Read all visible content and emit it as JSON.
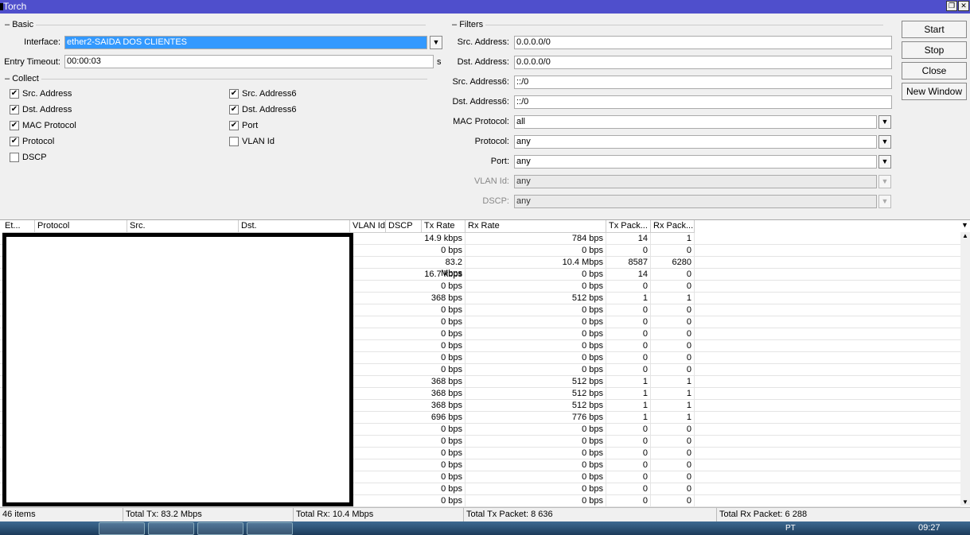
{
  "window": {
    "title": "Torch"
  },
  "basic": {
    "legend": "Basic",
    "interface_label": "Interface:",
    "interface_value": "ether2-SAIDA DOS CLIENTES",
    "timeout_label": "Entry Timeout:",
    "timeout_value": "00:00:03",
    "timeout_unit": "s"
  },
  "collect": {
    "legend": "Collect",
    "items": [
      {
        "label": "Src. Address",
        "checked": true
      },
      {
        "label": "Dst. Address",
        "checked": true
      },
      {
        "label": "MAC Protocol",
        "checked": true
      },
      {
        "label": "Protocol",
        "checked": true
      },
      {
        "label": "DSCP",
        "checked": false
      },
      {
        "label": "Src. Address6",
        "checked": true
      },
      {
        "label": "Dst. Address6",
        "checked": true
      },
      {
        "label": "Port",
        "checked": true
      },
      {
        "label": "VLAN Id",
        "checked": false
      }
    ]
  },
  "filters": {
    "legend": "Filters",
    "items": [
      {
        "label": "Src. Address:",
        "value": "0.0.0.0/0",
        "dropdown": false,
        "disabled": false
      },
      {
        "label": "Dst. Address:",
        "value": "0.0.0.0/0",
        "dropdown": false,
        "disabled": false
      },
      {
        "label": "Src. Address6:",
        "value": "::/0",
        "dropdown": false,
        "disabled": false
      },
      {
        "label": "Dst. Address6:",
        "value": "::/0",
        "dropdown": false,
        "disabled": false
      },
      {
        "label": "MAC Protocol:",
        "value": "all",
        "dropdown": true,
        "disabled": false
      },
      {
        "label": "Protocol:",
        "value": "any",
        "dropdown": true,
        "disabled": false
      },
      {
        "label": "Port:",
        "value": "any",
        "dropdown": true,
        "disabled": false
      },
      {
        "label": "VLAN Id:",
        "value": "any",
        "dropdown": true,
        "disabled": true
      },
      {
        "label": "DSCP:",
        "value": "any",
        "dropdown": true,
        "disabled": true
      }
    ]
  },
  "buttons": {
    "start": "Start",
    "stop": "Stop",
    "close": "Close",
    "new_window": "New Window"
  },
  "table": {
    "columns": [
      "Et...",
      "Protocol",
      "Src.",
      "Dst.",
      "VLAN Id",
      "DSCP",
      "Tx Rate",
      "Rx Rate",
      "Tx Pack...",
      "Rx Pack..."
    ],
    "rows": [
      [
        "14.9 kbps",
        "784 bps",
        "14",
        "1"
      ],
      [
        "0 bps",
        "0 bps",
        "0",
        "0"
      ],
      [
        "83.2 Mbps",
        "10.4 Mbps",
        "8587",
        "6280"
      ],
      [
        "16.7 kbps",
        "0 bps",
        "14",
        "0"
      ],
      [
        "0 bps",
        "0 bps",
        "0",
        "0"
      ],
      [
        "368 bps",
        "512 bps",
        "1",
        "1"
      ],
      [
        "0 bps",
        "0 bps",
        "0",
        "0"
      ],
      [
        "0 bps",
        "0 bps",
        "0",
        "0"
      ],
      [
        "0 bps",
        "0 bps",
        "0",
        "0"
      ],
      [
        "0 bps",
        "0 bps",
        "0",
        "0"
      ],
      [
        "0 bps",
        "0 bps",
        "0",
        "0"
      ],
      [
        "0 bps",
        "0 bps",
        "0",
        "0"
      ],
      [
        "368 bps",
        "512 bps",
        "1",
        "1"
      ],
      [
        "368 bps",
        "512 bps",
        "1",
        "1"
      ],
      [
        "368 bps",
        "512 bps",
        "1",
        "1"
      ],
      [
        "696 bps",
        "776 bps",
        "1",
        "1"
      ],
      [
        "0 bps",
        "0 bps",
        "0",
        "0"
      ],
      [
        "0 bps",
        "0 bps",
        "0",
        "0"
      ],
      [
        "0 bps",
        "0 bps",
        "0",
        "0"
      ],
      [
        "0 bps",
        "0 bps",
        "0",
        "0"
      ],
      [
        "0 bps",
        "0 bps",
        "0",
        "0"
      ],
      [
        "0 bps",
        "0 bps",
        "0",
        "0"
      ],
      [
        "0 bps",
        "0 bps",
        "0",
        "0"
      ]
    ]
  },
  "status": {
    "items": "46 items",
    "total_tx": "Total Tx: 83.2 Mbps",
    "total_rx": "Total Rx: 10.4 Mbps",
    "total_tx_packet": "Total Tx Packet: 8 636",
    "total_rx_packet": "Total Rx Packet: 6 288"
  },
  "taskbar": {
    "lang": "PT",
    "clock": "09:27"
  },
  "colors": {
    "titlebar": "#4f4fcc",
    "selection": "#3399ff"
  }
}
